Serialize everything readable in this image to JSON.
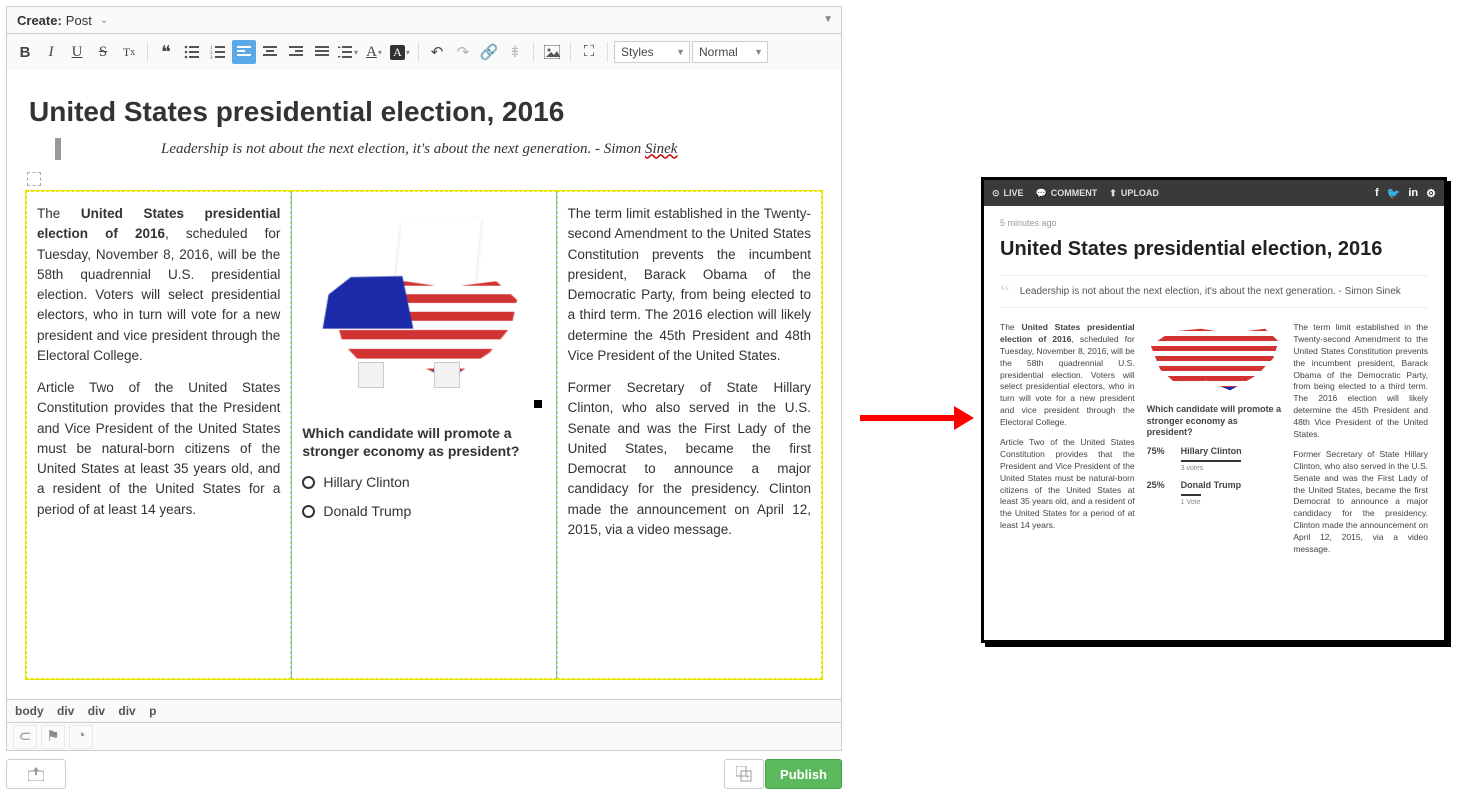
{
  "create": {
    "label": "Create:",
    "value": "Post"
  },
  "toolbar": {
    "styles": "Styles",
    "normal": "Normal"
  },
  "doc": {
    "title": "United States presidential election, 2016",
    "quote": "Leadership is not about the next election, it's about the next generation. - Simon ",
    "quote_underlined": "Sinek"
  },
  "colA": {
    "p1_pre": "The ",
    "p1_bold": "United States presidential election of 2016",
    "p1_post": ", scheduled for Tuesday, November 8, 2016, will be the 58th quadrennial U.S. presidential election. Voters will select presidential electors, who in turn will vote for a new president and vice president through the Electoral College.",
    "p2": "Article Two of the United States Constitution provides that the President and Vice President of the United States must be natural-born citizens of the United States at least 35 years old, and a resident of the United States for a period of at least 14 years."
  },
  "poll": {
    "q": "Which candidate will promote a stronger economy as president?",
    "opt1": "Hillary Clinton",
    "opt2": "Donald Trump"
  },
  "colC": {
    "p1": "The term limit established in the Twenty-second Amendment to the United States Constitution prevents the incumbent president, Barack Obama of the Democratic Party, from being elected to a third term. The 2016 election will likely determine the 45th President and 48th Vice President of the United States.",
    "p2": "Former Secretary of State Hillary Clinton, who also served in the U.S. Senate and was the First Lady of the United States, became the first Democrat to announce a major candidacy for the presidency. Clinton made the announcement on April 12, 2015, via a video message."
  },
  "breadcrumb": [
    "body",
    "div",
    "div",
    "div",
    "p"
  ],
  "publish": "Publish",
  "preview": {
    "bar": {
      "live": "LIVE",
      "comment": "COMMENT",
      "upload": "UPLOAD"
    },
    "time": "5 minutes ago",
    "title": "United States presidential election, 2016",
    "quote": "Leadership is not about the next election, it's about the next generation. - Simon Sinek",
    "colA": {
      "p1_pre": "The ",
      "p1_bold": "United States presidential election of 2016",
      "p1_post": ", scheduled for Tuesday, November 8, 2016, will be the 58th quadrennial U.S. presidential election. Voters will select presidential electors, who in turn will vote for a new president and vice president through the Electoral College.",
      "p2": "Article Two of the United States Constitution provides that the President and Vice President of the United States must be natural-born citizens of the United States at least 35 years old, and a resident of the United States for a period of at least 14 years."
    },
    "poll": {
      "q": "Which candidate will promote a stronger economy as president?",
      "r1": {
        "pct": "75%",
        "name": "Hillary Clinton",
        "sub": "3 votes"
      },
      "r2": {
        "pct": "25%",
        "name": "Donald Trump",
        "sub": "1 Vote"
      }
    },
    "colC": {
      "p1": "The term limit established in the Twenty-second Amendment to the United States Constitution prevents the incumbent president, Barack Obama of the Democratic Party, from being elected to a third term. The 2016 election will likely determine the 45th President and 48th Vice President of the United States.",
      "p2": "Former Secretary of State Hillary Clinton, who also served in the U.S. Senate and was the First Lady of the United States, became the first Democrat to announce a major candidacy for the presidency. Clinton made the announcement on April 12, 2015, via a video message."
    }
  }
}
